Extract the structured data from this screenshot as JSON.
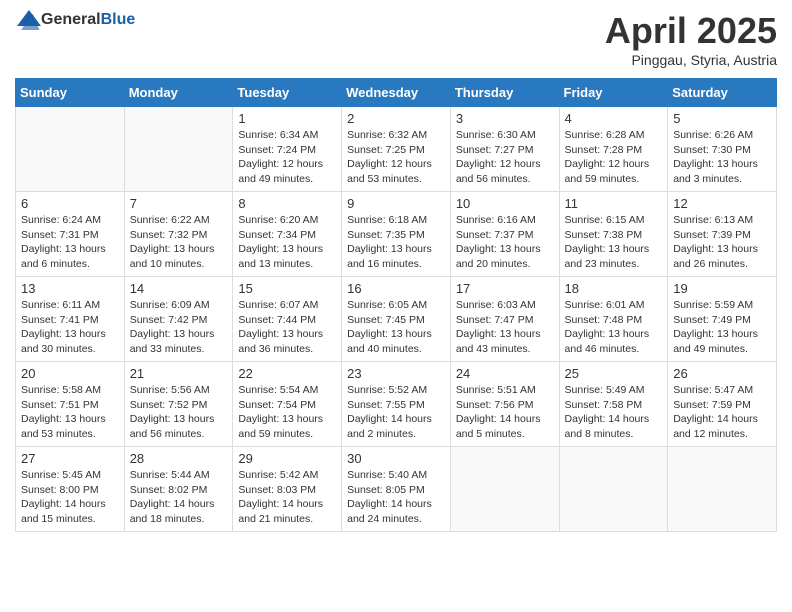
{
  "header": {
    "logo_general": "General",
    "logo_blue": "Blue",
    "month_title": "April 2025",
    "subtitle": "Pinggau, Styria, Austria"
  },
  "weekdays": [
    "Sunday",
    "Monday",
    "Tuesday",
    "Wednesday",
    "Thursday",
    "Friday",
    "Saturday"
  ],
  "weeks": [
    [
      {
        "day": "",
        "info": ""
      },
      {
        "day": "",
        "info": ""
      },
      {
        "day": "1",
        "info": "Sunrise: 6:34 AM\nSunset: 7:24 PM\nDaylight: 12 hours and 49 minutes."
      },
      {
        "day": "2",
        "info": "Sunrise: 6:32 AM\nSunset: 7:25 PM\nDaylight: 12 hours and 53 minutes."
      },
      {
        "day": "3",
        "info": "Sunrise: 6:30 AM\nSunset: 7:27 PM\nDaylight: 12 hours and 56 minutes."
      },
      {
        "day": "4",
        "info": "Sunrise: 6:28 AM\nSunset: 7:28 PM\nDaylight: 12 hours and 59 minutes."
      },
      {
        "day": "5",
        "info": "Sunrise: 6:26 AM\nSunset: 7:30 PM\nDaylight: 13 hours and 3 minutes."
      }
    ],
    [
      {
        "day": "6",
        "info": "Sunrise: 6:24 AM\nSunset: 7:31 PM\nDaylight: 13 hours and 6 minutes."
      },
      {
        "day": "7",
        "info": "Sunrise: 6:22 AM\nSunset: 7:32 PM\nDaylight: 13 hours and 10 minutes."
      },
      {
        "day": "8",
        "info": "Sunrise: 6:20 AM\nSunset: 7:34 PM\nDaylight: 13 hours and 13 minutes."
      },
      {
        "day": "9",
        "info": "Sunrise: 6:18 AM\nSunset: 7:35 PM\nDaylight: 13 hours and 16 minutes."
      },
      {
        "day": "10",
        "info": "Sunrise: 6:16 AM\nSunset: 7:37 PM\nDaylight: 13 hours and 20 minutes."
      },
      {
        "day": "11",
        "info": "Sunrise: 6:15 AM\nSunset: 7:38 PM\nDaylight: 13 hours and 23 minutes."
      },
      {
        "day": "12",
        "info": "Sunrise: 6:13 AM\nSunset: 7:39 PM\nDaylight: 13 hours and 26 minutes."
      }
    ],
    [
      {
        "day": "13",
        "info": "Sunrise: 6:11 AM\nSunset: 7:41 PM\nDaylight: 13 hours and 30 minutes."
      },
      {
        "day": "14",
        "info": "Sunrise: 6:09 AM\nSunset: 7:42 PM\nDaylight: 13 hours and 33 minutes."
      },
      {
        "day": "15",
        "info": "Sunrise: 6:07 AM\nSunset: 7:44 PM\nDaylight: 13 hours and 36 minutes."
      },
      {
        "day": "16",
        "info": "Sunrise: 6:05 AM\nSunset: 7:45 PM\nDaylight: 13 hours and 40 minutes."
      },
      {
        "day": "17",
        "info": "Sunrise: 6:03 AM\nSunset: 7:47 PM\nDaylight: 13 hours and 43 minutes."
      },
      {
        "day": "18",
        "info": "Sunrise: 6:01 AM\nSunset: 7:48 PM\nDaylight: 13 hours and 46 minutes."
      },
      {
        "day": "19",
        "info": "Sunrise: 5:59 AM\nSunset: 7:49 PM\nDaylight: 13 hours and 49 minutes."
      }
    ],
    [
      {
        "day": "20",
        "info": "Sunrise: 5:58 AM\nSunset: 7:51 PM\nDaylight: 13 hours and 53 minutes."
      },
      {
        "day": "21",
        "info": "Sunrise: 5:56 AM\nSunset: 7:52 PM\nDaylight: 13 hours and 56 minutes."
      },
      {
        "day": "22",
        "info": "Sunrise: 5:54 AM\nSunset: 7:54 PM\nDaylight: 13 hours and 59 minutes."
      },
      {
        "day": "23",
        "info": "Sunrise: 5:52 AM\nSunset: 7:55 PM\nDaylight: 14 hours and 2 minutes."
      },
      {
        "day": "24",
        "info": "Sunrise: 5:51 AM\nSunset: 7:56 PM\nDaylight: 14 hours and 5 minutes."
      },
      {
        "day": "25",
        "info": "Sunrise: 5:49 AM\nSunset: 7:58 PM\nDaylight: 14 hours and 8 minutes."
      },
      {
        "day": "26",
        "info": "Sunrise: 5:47 AM\nSunset: 7:59 PM\nDaylight: 14 hours and 12 minutes."
      }
    ],
    [
      {
        "day": "27",
        "info": "Sunrise: 5:45 AM\nSunset: 8:00 PM\nDaylight: 14 hours and 15 minutes."
      },
      {
        "day": "28",
        "info": "Sunrise: 5:44 AM\nSunset: 8:02 PM\nDaylight: 14 hours and 18 minutes."
      },
      {
        "day": "29",
        "info": "Sunrise: 5:42 AM\nSunset: 8:03 PM\nDaylight: 14 hours and 21 minutes."
      },
      {
        "day": "30",
        "info": "Sunrise: 5:40 AM\nSunset: 8:05 PM\nDaylight: 14 hours and 24 minutes."
      },
      {
        "day": "",
        "info": ""
      },
      {
        "day": "",
        "info": ""
      },
      {
        "day": "",
        "info": ""
      }
    ]
  ]
}
